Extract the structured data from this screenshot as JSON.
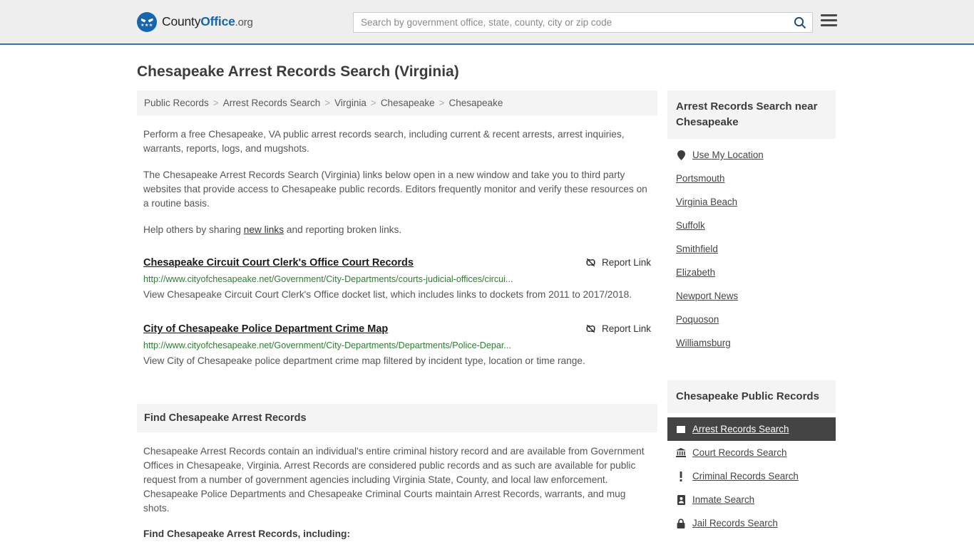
{
  "header": {
    "logo": {
      "part1": "County",
      "part2": "Office",
      "part3": ".org",
      "icon": "eagle-logo-icon",
      "stars": "★★★"
    },
    "search": {
      "placeholder": "Search by government office, state, county, city or zip code",
      "value": "",
      "search_icon": "search-icon"
    },
    "menu_icon": "hamburger-menu-icon"
  },
  "page": {
    "title": "Chesapeake Arrest Records Search (Virginia)"
  },
  "breadcrumb": {
    "items": [
      {
        "label": "Public Records"
      },
      {
        "label": "Arrest Records Search"
      },
      {
        "label": "Virginia"
      },
      {
        "label": "Chesapeake"
      },
      {
        "label": "Chesapeake"
      }
    ],
    "separator": ">"
  },
  "intro": {
    "p1": "Perform a free Chesapeake, VA public arrest records search, including current & recent arrests, arrest inquiries, warrants, reports, logs, and mugshots.",
    "p2": "The Chesapeake Arrest Records Search (Virginia) links below open in a new window and take you to third party websites that provide access to Chesapeake public records. Editors frequently monitor and verify these resources on a routine basis.",
    "p3_before": "Help others by sharing ",
    "p3_link": "new links",
    "p3_after": " and reporting broken links."
  },
  "results": [
    {
      "title": "Chesapeake Circuit Court Clerk's Office Court Records",
      "url": "http://www.cityofchesapeake.net/Government/City-Departments/courts-judicial-offices/circui...",
      "description": "View Chesapeake Circuit Court Clerk's Office docket list, which includes links to dockets from 2011 to 2017/2018.",
      "report_label": "Report Link",
      "report_icon": "unlink-icon"
    },
    {
      "title": "City of Chesapeake Police Department Crime Map",
      "url": "http://www.cityofchesapeake.net/Government/City-Departments/Departments/Police-Depar...",
      "description": "View City of Chesapeake police department crime map filtered by incident type, location or time range.",
      "report_label": "Report Link",
      "report_icon": "unlink-icon"
    }
  ],
  "find_section": {
    "heading": "Find Chesapeake Arrest Records",
    "body": "Chesapeake Arrest Records contain an individual's entire criminal history record and are available from Government Offices in Chesapeake, Virginia. Arrest Records are considered public records and as such are available for public request from a number of government agencies including Virginia State, County, and local law enforcement. Chesapeake Police Departments and Chesapeake Criminal Courts maintain Arrest Records, warrants, and mug shots.",
    "subheading": "Find Chesapeake Arrest Records, including:"
  },
  "sidebar": {
    "near": {
      "heading": "Arrest Records Search near Chesapeake",
      "items": [
        {
          "label": "Use My Location",
          "icon": "map-pin-icon"
        },
        {
          "label": "Portsmouth",
          "icon": ""
        },
        {
          "label": "Virginia Beach",
          "icon": ""
        },
        {
          "label": "Suffolk",
          "icon": ""
        },
        {
          "label": "Smithfield",
          "icon": ""
        },
        {
          "label": "Elizabeth",
          "icon": ""
        },
        {
          "label": "Newport News",
          "icon": ""
        },
        {
          "label": "Poquoson",
          "icon": ""
        },
        {
          "label": "Williamsburg",
          "icon": ""
        }
      ]
    },
    "public_records": {
      "heading": "Chesapeake Public Records",
      "items": [
        {
          "label": "Arrest Records Search",
          "icon": "square-icon",
          "active": true
        },
        {
          "label": "Court Records Search",
          "icon": "courthouse-icon",
          "active": false
        },
        {
          "label": "Criminal Records Search",
          "icon": "exclamation-icon",
          "active": false
        },
        {
          "label": "Inmate Search",
          "icon": "id-badge-icon",
          "active": false
        },
        {
          "label": "Jail Records Search",
          "icon": "lock-icon",
          "active": false
        }
      ]
    }
  },
  "colors": {
    "header_bg": "#eeeeee",
    "header_border": "#3b73ad",
    "brand_blue": "#1565b0",
    "panel_bg": "#f4f4f4",
    "url_green": "#2e7d32",
    "active_bg": "#444444",
    "body_text": "#555555"
  }
}
